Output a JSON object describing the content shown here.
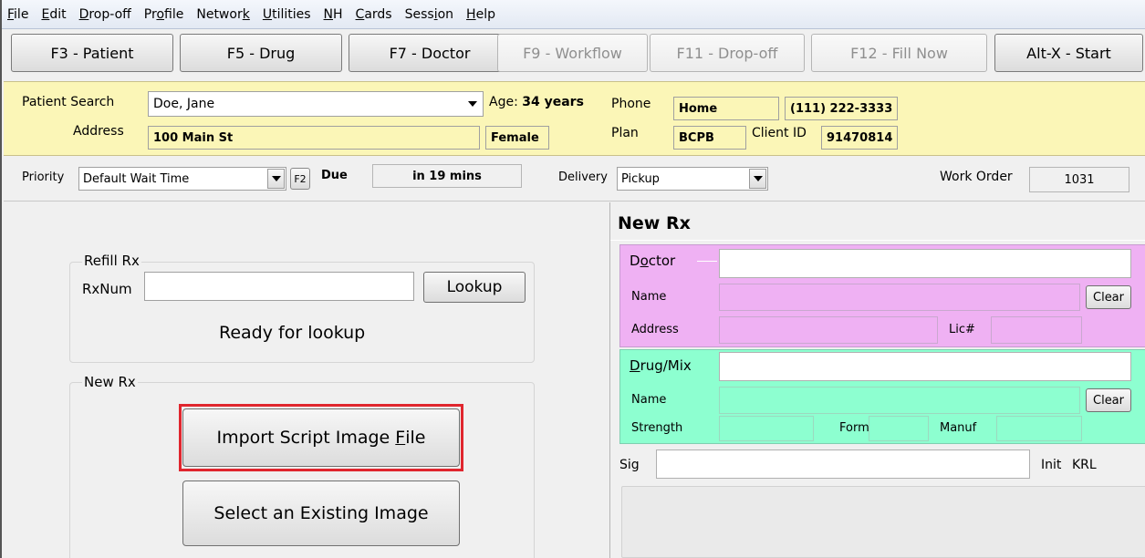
{
  "menu": {
    "items": [
      {
        "pre": "",
        "u": "F",
        "post": "ile"
      },
      {
        "pre": "",
        "u": "E",
        "post": "dit"
      },
      {
        "pre": "",
        "u": "D",
        "post": "rop-off"
      },
      {
        "pre": "Pr",
        "u": "o",
        "post": "file"
      },
      {
        "pre": "Networ",
        "u": "k",
        "post": ""
      },
      {
        "pre": "",
        "u": "U",
        "post": "tilities"
      },
      {
        "pre": "",
        "u": "N",
        "post": "H"
      },
      {
        "pre": "",
        "u": "C",
        "post": "ards"
      },
      {
        "pre": "Sess",
        "u": "i",
        "post": "on"
      },
      {
        "pre": "",
        "u": "H",
        "post": "elp"
      }
    ]
  },
  "toolbar": {
    "f3": "F3 - Patient",
    "f5": "F5 - Drug",
    "f7": "F7 - Doctor",
    "f9": "F9 - Workflow",
    "f11": "F11 - Drop-off",
    "f12": "F12 - Fill Now",
    "altx": "Alt-X - Start"
  },
  "patient": {
    "search_label": "Patient Search",
    "search_value": "Doe, Jane",
    "age_label": "Age:",
    "age_value": "34 years",
    "phone_label": "Phone",
    "phone_type": "Home",
    "phone_value": "(111) 222-3333",
    "address_label": "Address",
    "address_value": "100 Main St",
    "gender": "Female",
    "plan_label": "Plan",
    "plan_value": "BCPB",
    "client_id_label": "Client ID",
    "client_id_value": "91470814"
  },
  "order": {
    "priority_label": "Priority",
    "priority_value": "Default Wait Time",
    "f2_label": "F2",
    "due_label": "Due",
    "due_value": "in 19 mins",
    "delivery_label": "Delivery",
    "delivery_value": "Pickup",
    "work_order_label": "Work Order",
    "work_order_value": "1031"
  },
  "refill": {
    "group_title": "Refill Rx",
    "rxnum_label": "RxNum",
    "rxnum_value": "",
    "lookup_label": "Lookup",
    "status": "Ready for lookup"
  },
  "new_rx_left": {
    "group_title": "New Rx",
    "import_label": "Import Script Image ",
    "import_mnemonic": "F",
    "import_label_end": "ile",
    "select_label": "Select an Existing Image"
  },
  "new_rx": {
    "title": "New Rx",
    "doctor_pre": "D",
    "doctor_mnemonic": "o",
    "doctor_post": "ctor",
    "doctor_name_label": "Name",
    "doctor_address_label": "Address",
    "lic_label": "Lic#",
    "clear_label": "Clear",
    "drug_mnemonic": "D",
    "drug_post": "rug/Mix",
    "drug_name_label": "Name",
    "strength_label": "Strength",
    "form_label": "Form",
    "manuf_label": "Manuf",
    "drug_clear_label": "Clear",
    "sig_label": "Sig",
    "init_label": "Init",
    "init_value": "KRL"
  }
}
